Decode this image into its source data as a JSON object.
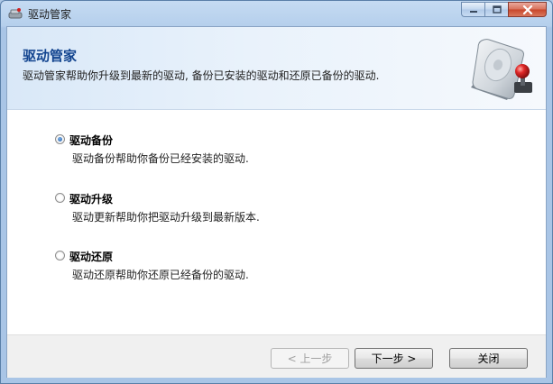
{
  "window": {
    "title": "驱动管家"
  },
  "header": {
    "title": "驱动管家",
    "subtitle": "驱动管家帮助你升级到最新的驱动, 备份已安装的驱动和还原已备份的驱动."
  },
  "options": [
    {
      "label": "驱动备份",
      "description": "驱动备份帮助你备份已经安装的驱动.",
      "selected": true
    },
    {
      "label": "驱动升级",
      "description": "驱动更新帮助你把驱动升级到最新版本.",
      "selected": false
    },
    {
      "label": "驱动还原",
      "description": "驱动还原帮助你还原已经备份的驱动.",
      "selected": false
    }
  ],
  "footer": {
    "back_label": "< 上一步",
    "next_label": "下一步 >",
    "close_label": "关闭"
  },
  "colors": {
    "title_blue": "#12448f",
    "close_red": "#c8452a"
  },
  "icons": [
    "app-icon",
    "minimize-icon",
    "maximize-icon",
    "close-icon",
    "hard-drive-icon",
    "radio-button-icon"
  ]
}
